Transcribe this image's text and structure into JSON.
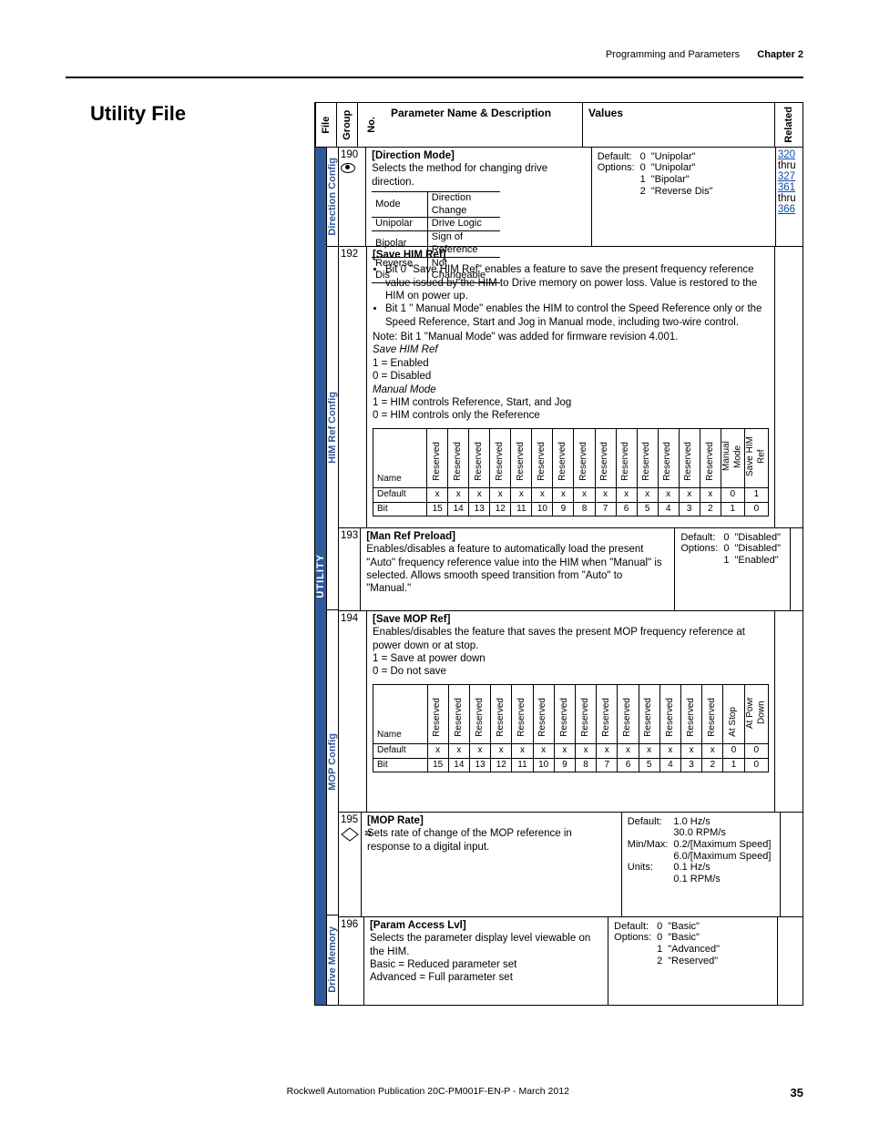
{
  "running_head": {
    "left": "Programming and Parameters",
    "right": "Chapter 2"
  },
  "section_title": "Utility File",
  "footer": {
    "pub": "Rockwell Automation Publication 20C-PM001F-EN-P - March 2012",
    "page": "35"
  },
  "columns": {
    "file": "File",
    "group": "Group",
    "no": "No.",
    "descr": "Parameter Name & Description",
    "values": "Values",
    "related": "Related"
  },
  "file_label": "UTILITY",
  "groups": {
    "direction": "Direction Config",
    "himref": "HIM Ref Config",
    "mop": "MOP Config",
    "drivemem": "Drive Memory"
  },
  "p190": {
    "no": "190",
    "name": "[Direction Mode]",
    "descr": "Selects the method for changing drive direction.",
    "mode_hdr_l": "Mode",
    "mode_hdr_r": "Direction Change",
    "modes": [
      [
        "Unipolar",
        "Drive Logic"
      ],
      [
        "Bipolar",
        "Sign of Reference"
      ],
      [
        "Reverse Dis",
        "Not Changeable"
      ]
    ],
    "default_lbl": "Default:",
    "default_vals": "0",
    "default_txt": "\"Unipolar\"",
    "options_lbl": "Options:",
    "options": [
      [
        "0",
        "\"Unipolar\""
      ],
      [
        "1",
        "\"Bipolar\""
      ],
      [
        "2",
        "\"Reverse Dis\""
      ]
    ],
    "rel": [
      "320",
      "thru",
      "327",
      "361",
      "thru",
      "366"
    ]
  },
  "p192": {
    "no": "192",
    "name": "[Save HIM Ref]",
    "bullets": [
      "Bit 0 \"Save HIM Ref\" enables a feature to save the present frequency reference value issued by the HIM to Drive memory on power loss. Value is restored to the HIM on power up.",
      "Bit 1 \" Manual Mode\" enables the HIM to control the Speed Reference only or the Speed Reference, Start and Jog in Manual mode, including two-wire control."
    ],
    "note": "Note: Bit 1 \"Manual Mode\" was added for firmware revision 4.001.",
    "savehim_lbl": "Save HIM Ref",
    "sv1": "1 = Enabled",
    "sv0": "0 = Disabled",
    "manmode_lbl": "Manual Mode",
    "mm1": "1 = HIM controls Reference, Start, and Jog",
    "mm0": "0 = HIM controls only the Reference",
    "bit_name": "Name",
    "bit_hdrs": [
      "Reserved",
      "Reserved",
      "Reserved",
      "Reserved",
      "Reserved",
      "Reserved",
      "Reserved",
      "Reserved",
      "Reserved",
      "Reserved",
      "Reserved",
      "Reserved",
      "Reserved",
      "Reserved",
      "Manual Mode",
      "Save HIM Ref"
    ],
    "default_row_lbl": "Default",
    "default_row": [
      "x",
      "x",
      "x",
      "x",
      "x",
      "x",
      "x",
      "x",
      "x",
      "x",
      "x",
      "x",
      "x",
      "x",
      "0",
      "1"
    ],
    "bit_row_lbl": "Bit",
    "bit_row": [
      "15",
      "14",
      "13",
      "12",
      "11",
      "10",
      "9",
      "8",
      "7",
      "6",
      "5",
      "4",
      "3",
      "2",
      "1",
      "0"
    ]
  },
  "p193": {
    "no": "193",
    "name": "[Man Ref Preload]",
    "descr": "Enables/disables a feature to automatically load the present \"Auto\" frequency reference value into the HIM when \"Manual\" is selected. Allows smooth speed transition from \"Auto\" to \"Manual.\"",
    "default_lbl": "Default:",
    "default_vals": "0",
    "default_txt": "\"Disabled\"",
    "options_lbl": "Options:",
    "options": [
      [
        "0",
        "\"Disabled\""
      ],
      [
        "1",
        "\"Enabled\""
      ]
    ]
  },
  "p194": {
    "no": "194",
    "name": "[Save MOP Ref]",
    "descr": "Enables/disables the feature that saves the present MOP frequency reference at power down or at stop.",
    "l1": "1 = Save at power down",
    "l0": "0 = Do not save",
    "bit_name": "Name",
    "bit_hdrs": [
      "Reserved",
      "Reserved",
      "Reserved",
      "Reserved",
      "Reserved",
      "Reserved",
      "Reserved",
      "Reserved",
      "Reserved",
      "Reserved",
      "Reserved",
      "Reserved",
      "Reserved",
      "Reserved",
      "At Stop",
      "At Powr Down"
    ],
    "default_row_lbl": "Default",
    "default_row": [
      "x",
      "x",
      "x",
      "x",
      "x",
      "x",
      "x",
      "x",
      "x",
      "x",
      "x",
      "x",
      "x",
      "x",
      "0",
      "0"
    ],
    "bit_row_lbl": "Bit",
    "bit_row": [
      "15",
      "14",
      "13",
      "12",
      "11",
      "10",
      "9",
      "8",
      "7",
      "6",
      "5",
      "4",
      "3",
      "2",
      "1",
      "0"
    ]
  },
  "p195": {
    "no": "195",
    "icon32": "32",
    "name": "[MOP Rate]",
    "descr": "Sets rate of change of the MOP reference in response to a digital input.",
    "default_lbl": "Default:",
    "default_vals": [
      "1.0 Hz/s",
      "30.0 RPM/s"
    ],
    "minmax_lbl": "Min/Max:",
    "minmax_vals": [
      "0.2/[Maximum Speed]",
      "6.0/[Maximum Speed]"
    ],
    "units_lbl": "Units:",
    "units_vals": [
      "0.1 Hz/s",
      "0.1 RPM/s"
    ]
  },
  "p196": {
    "no": "196",
    "name": "[Param Access Lvl]",
    "descr": "Selects the parameter display level viewable on the HIM.",
    "l1": "Basic = Reduced parameter set",
    "l2": "Advanced = Full parameter set",
    "default_lbl": "Default:",
    "default_vals": "0",
    "default_txt": "\"Basic\"",
    "options_lbl": "Options:",
    "options": [
      [
        "0",
        "\"Basic\""
      ],
      [
        "1",
        "\"Advanced\""
      ],
      [
        "2",
        "\"Reserved\""
      ]
    ]
  }
}
